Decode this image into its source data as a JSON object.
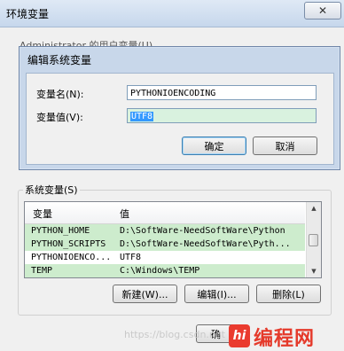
{
  "outer_window": {
    "title": "环境变量",
    "close_glyph": "✕"
  },
  "user_group": {
    "label": "Administrator 的用户变量(U)"
  },
  "edit_dialog": {
    "title": "编辑系统变量",
    "name_label": "变量名(N):",
    "name_value": "PYTHONIOENCODING",
    "value_label": "变量值(V):",
    "value_value": "UTF8",
    "ok_label": "确定",
    "cancel_label": "取消"
  },
  "system_vars": {
    "label": "系统变量(S)",
    "columns": [
      "变量",
      "值"
    ],
    "rows": [
      {
        "name": "PYTHON_HOME",
        "value": "D:\\SoftWare-NeedSoftWare\\Python"
      },
      {
        "name": "PYTHON_SCRIPTS",
        "value": "D:\\SoftWare-NeedSoftWare\\Pyth..."
      },
      {
        "name": "PYTHONIOENCO...",
        "value": "UTF8"
      },
      {
        "name": "TEMP",
        "value": "C:\\Windows\\TEMP"
      }
    ],
    "new_label": "新建(W)...",
    "edit_label": "编辑(I)...",
    "delete_label": "删除(L)"
  },
  "bottom": {
    "ok_partial": "确"
  },
  "watermark": {
    "text": "https://blog.csdn.net",
    "logo_badge": "hi",
    "logo_text": "编程网",
    "logo_color": "#e53a2b"
  }
}
